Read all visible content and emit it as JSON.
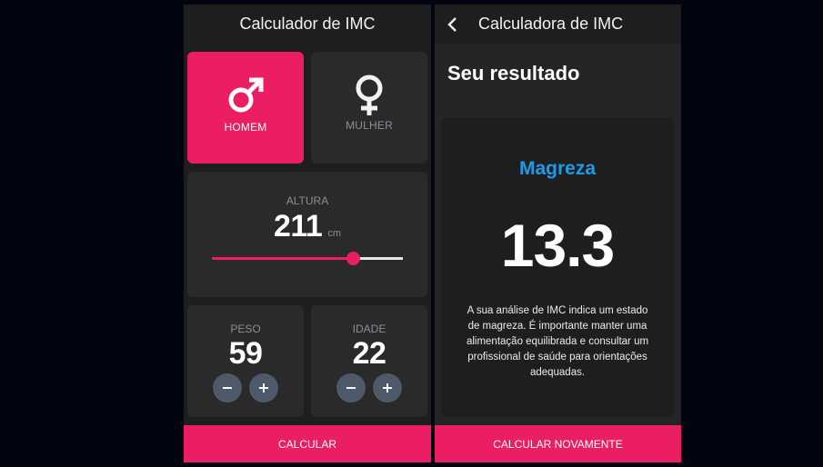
{
  "left_screen": {
    "title": "Calculador de IMC",
    "gender": {
      "male_label": "HOMEM",
      "female_label": "MULHER",
      "selected": "male",
      "male_icon": "male-symbol-icon",
      "female_icon": "female-symbol-icon"
    },
    "height": {
      "label": "ALTURA",
      "value": "211",
      "unit": "cm",
      "slider_fraction": 0.74
    },
    "weight": {
      "label": "PESO",
      "value": "59"
    },
    "age": {
      "label": "IDADE",
      "value": "22"
    },
    "calculate_label": "CALCULAR"
  },
  "right_screen": {
    "title": "Calculadora de IMC",
    "back_icon": "chevron-left-icon",
    "heading": "Seu resultado",
    "result_category": "Magreza",
    "bmi_value": "13.3",
    "description": "A sua análise de IMC indica um estado de magreza. É importante manter uma alimentação equilibrada e consultar um profissional de saúde para orientações adequadas.",
    "recalculate_label": "CALCULAR NOVAMENTE"
  },
  "colors": {
    "accent": "#eb1e63",
    "category": "#1e9be8",
    "card": "#2a2a2a",
    "stepper": "#4c5a6a"
  }
}
